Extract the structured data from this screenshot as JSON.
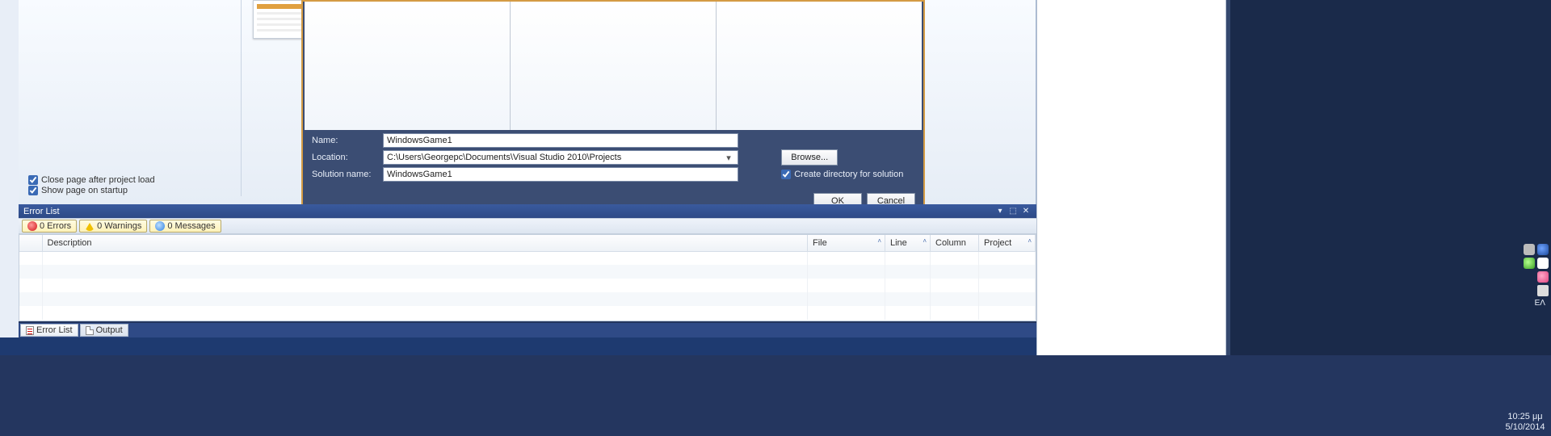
{
  "startpage": {
    "close_after_load": "Close page after project load",
    "show_on_startup": "Show page on startup"
  },
  "dialog": {
    "labels": {
      "name": "Name:",
      "location": "Location:",
      "solution_name": "Solution name:"
    },
    "name_value": "WindowsGame1",
    "location_value": "C:\\Users\\Georgepc\\Documents\\Visual Studio 2010\\Projects",
    "solution_name_value": "WindowsGame1",
    "browse": "Browse...",
    "create_dir": "Create directory for solution",
    "ok": "OK",
    "cancel": "Cancel"
  },
  "error_list": {
    "title": "Error List",
    "errors": "0 Errors",
    "warnings": "0 Warnings",
    "messages": "0 Messages",
    "columns": {
      "description": "Description",
      "file": "File",
      "line": "Line",
      "column": "Column",
      "project": "Project"
    }
  },
  "bottom_tabs": {
    "error_list": "Error List",
    "output": "Output"
  },
  "tray": {
    "lang": "ΕΛ",
    "time": "10:25 μμ",
    "date": "5/10/2014"
  }
}
